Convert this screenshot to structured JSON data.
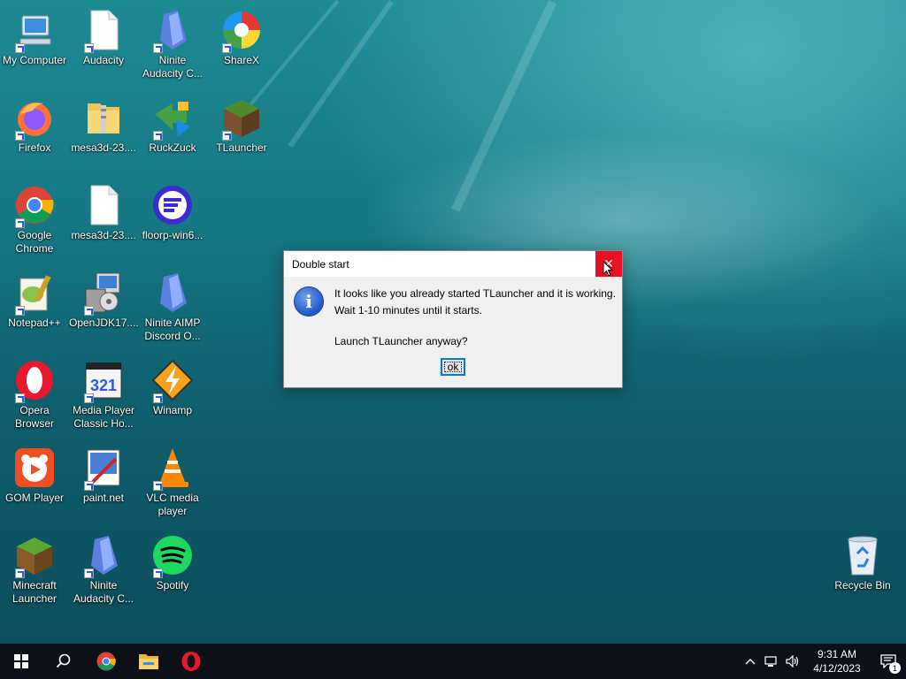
{
  "desktop": {
    "icons": [
      {
        "label": "My Computer",
        "icon": "computer-icon"
      },
      {
        "label": "Audacity",
        "icon": "file-icon"
      },
      {
        "label": "Ninite\nAudacity C...",
        "icon": "ninite-icon"
      },
      {
        "label": "ShareX",
        "icon": "sharex-icon"
      },
      {
        "label": "Firefox",
        "icon": "firefox-icon"
      },
      {
        "label": "mesa3d-23....",
        "icon": "folder-zip-icon"
      },
      {
        "label": "RuckZuck",
        "icon": "ruckzuck-icon"
      },
      {
        "label": "TLauncher",
        "icon": "tlauncher-icon"
      },
      {
        "label": "Google\nChrome",
        "icon": "chrome-icon"
      },
      {
        "label": "mesa3d-23....",
        "icon": "file-icon"
      },
      {
        "label": "floorp-win6...",
        "icon": "floorp-icon"
      },
      {
        "label": "Notepad++",
        "icon": "notepadpp-icon"
      },
      {
        "label": "OpenJDK17....",
        "icon": "installer-icon"
      },
      {
        "label": "Ninite AIMP\nDiscord O...",
        "icon": "ninite-icon"
      },
      {
        "label": "Opera\nBrowser",
        "icon": "opera-icon"
      },
      {
        "label": "Media Player\nClassic Ho...",
        "icon": "mpc-icon"
      },
      {
        "label": "Winamp",
        "icon": "winamp-icon"
      },
      {
        "label": "GOM Player",
        "icon": "gom-icon"
      },
      {
        "label": "paint.net",
        "icon": "paintnet-icon"
      },
      {
        "label": "VLC media\nplayer",
        "icon": "vlc-icon"
      },
      {
        "label": "Minecraft\nLauncher",
        "icon": "minecraft-icon"
      },
      {
        "label": "Ninite\nAudacity C...",
        "icon": "ninite-icon"
      },
      {
        "label": "Spotify",
        "icon": "spotify-icon"
      },
      {
        "label": "Recycle Bin",
        "icon": "recycle-bin-icon"
      }
    ]
  },
  "dialog": {
    "title": "Double start",
    "line1": "It looks like you already started TLauncher and it is working.",
    "line2": "Wait 1-10 minutes until it starts.",
    "line3": "Launch TLauncher anyway?",
    "ok_label": "ok",
    "close_glyph": "✕"
  },
  "taskbar": {
    "pinned": [
      "start-icon",
      "search-icon",
      "chrome-icon",
      "file-explorer-icon",
      "opera-icon"
    ],
    "time": "9:31 AM",
    "date": "4/12/2023",
    "notification_count": "1"
  },
  "colors": {
    "close_red": "#e81123",
    "accent": "#0078d7",
    "taskbar": "#0d1117"
  }
}
